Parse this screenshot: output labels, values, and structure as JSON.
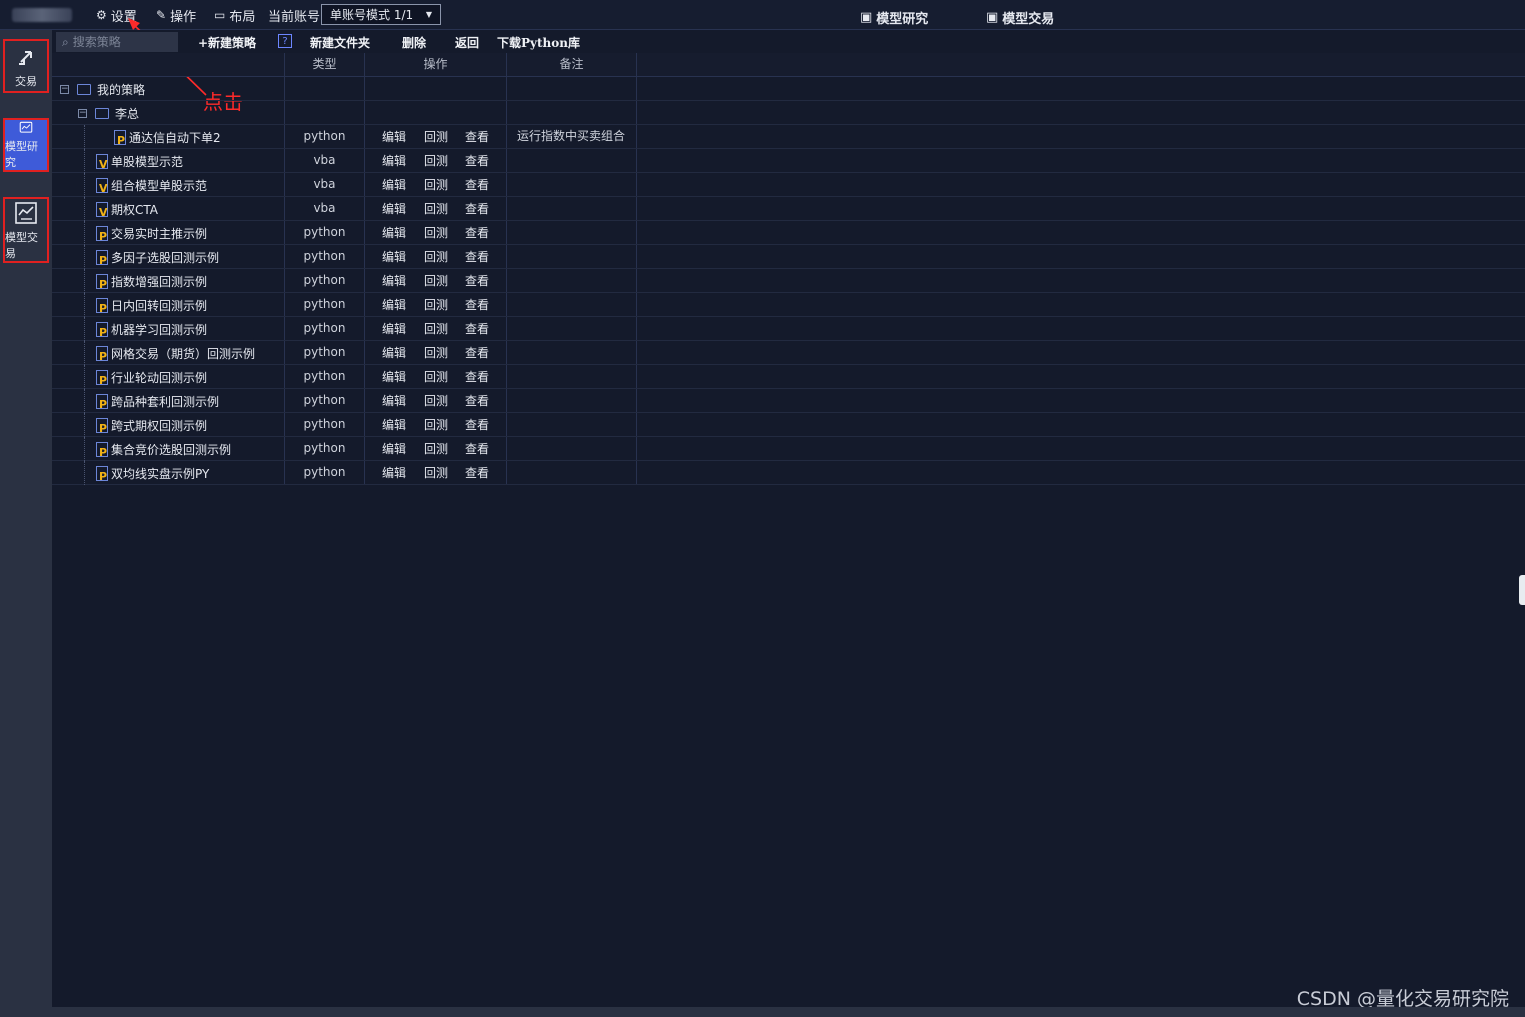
{
  "topbar": {
    "settings": "设置",
    "operate": "操作",
    "layout": "布局",
    "current_account_label": "当前账号",
    "account_mode": "单账号模式 1/1",
    "nav_research": "模型研究",
    "nav_trade": "模型交易"
  },
  "annotation": "点击",
  "sidebar": {
    "trade": "交易",
    "research": "模型研究",
    "model_trade": "模型交易"
  },
  "toolbar": {
    "search_placeholder": "搜索策略",
    "new_strategy": "+新建策略",
    "help": "?",
    "new_folder": "新建文件夹",
    "delete": "删除",
    "back": "返回",
    "download_python": "下载Python库"
  },
  "table": {
    "headers": {
      "type": "类型",
      "ops": "操作",
      "note": "备注"
    },
    "root_folder": "我的策略",
    "sub_folder": "李总",
    "ops": {
      "edit": "编辑",
      "backtest": "回测",
      "view": "查看"
    },
    "rows": [
      {
        "name": "通达信自动下单2",
        "type": "python",
        "icon": "P",
        "note": "运行指数中买卖组合",
        "nested": true
      },
      {
        "name": "单股模型示范",
        "type": "vba",
        "icon": "V",
        "note": ""
      },
      {
        "name": "组合模型单股示范",
        "type": "vba",
        "icon": "V",
        "note": ""
      },
      {
        "name": "期权CTA",
        "type": "vba",
        "icon": "V",
        "note": ""
      },
      {
        "name": "交易实时主推示例",
        "type": "python",
        "icon": "P",
        "note": ""
      },
      {
        "name": "多因子选股回测示例",
        "type": "python",
        "icon": "P",
        "note": ""
      },
      {
        "name": "指数增强回测示例",
        "type": "python",
        "icon": "P",
        "note": ""
      },
      {
        "name": "日内回转回测示例",
        "type": "python",
        "icon": "P",
        "note": ""
      },
      {
        "name": "机器学习回测示例",
        "type": "python",
        "icon": "P",
        "note": ""
      },
      {
        "name": "网格交易（期货）回测示例",
        "type": "python",
        "icon": "P",
        "note": ""
      },
      {
        "name": "行业轮动回测示例",
        "type": "python",
        "icon": "P",
        "note": ""
      },
      {
        "name": "跨品种套利回测示例",
        "type": "python",
        "icon": "P",
        "note": ""
      },
      {
        "name": "跨式期权回测示例",
        "type": "python",
        "icon": "P",
        "note": ""
      },
      {
        "name": "集合竞价选股回测示例",
        "type": "python",
        "icon": "P",
        "note": ""
      },
      {
        "name": "双均线实盘示例PY",
        "type": "python",
        "icon": "P",
        "note": ""
      }
    ]
  },
  "watermark": "CSDN @量化交易研究院",
  "colors": {
    "background": "#141a2b",
    "accent": "#3e5bd9",
    "highlight": "#e02020"
  }
}
